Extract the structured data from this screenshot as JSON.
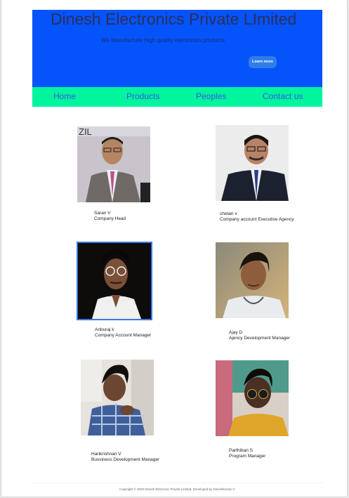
{
  "header": {
    "title": "Dinesh Electronics Private LImited",
    "subtitle": "We Manufacture High quality electronics  products",
    "learn_more": "Learn more"
  },
  "nav": {
    "items": [
      "Home",
      "Products",
      "Peoples",
      "Contact us"
    ]
  },
  "team": [
    {
      "name": "Saran V",
      "role": "Company Head"
    },
    {
      "name": "chetan v",
      "role": "Company account Executive Agency"
    },
    {
      "name": "Anburaj k",
      "role": "Company Account Manager"
    },
    {
      "name": "Ajay D",
      "role": "Ajency Development Manager"
    },
    {
      "name": "Harikrishnan V",
      "role": "Bussiness Development Manager"
    },
    {
      "name": "Parthiban S",
      "role": "Program Manager"
    }
  ],
  "footer": {
    "text": "Copyright © 2020 Dinesh Electronic Private Limited, Developed by Dineshkumar V."
  },
  "colors": {
    "hero_bg": "#0553fb",
    "nav_bg": "#00f59c",
    "nav_text": "#3b57e6",
    "button_bg": "#2f7de8"
  }
}
